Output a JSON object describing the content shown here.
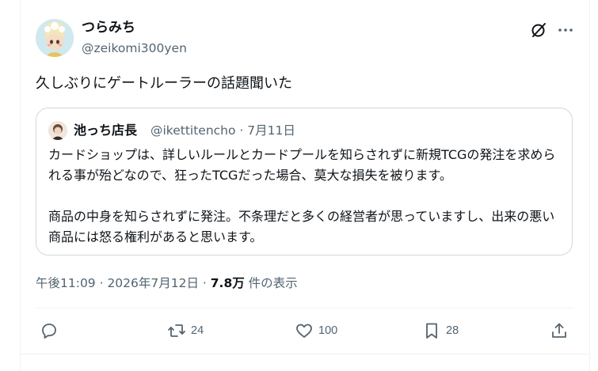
{
  "tweet": {
    "author_name": "つらみち",
    "author_handle": "@zeikomi300yen",
    "text": "久しぶりにゲートルーラーの話題聞いた"
  },
  "quote": {
    "author_name": "池っち店長",
    "author_handle_and_date": "@ikettitencho · 7月11日",
    "text": "カードショップは、詳しいルールとカードプールを知らされずに新規TCGの発注を求められる事が殆どなので、狂ったTCGだった場合、莫大な損失を被ります。\n\n商品の中身を知らされずに発注。不条理だと多くの経営者が思っていますし、出来の悪い商品には怒る権利があると思います。"
  },
  "meta": {
    "time": "午後11:09 · 2026年7月12日 · ",
    "views_count": "7.8万",
    "views_label": " 件の表示"
  },
  "actions": {
    "reply_count": "",
    "retweet_count": "24",
    "like_count": "100",
    "bookmark_count": "28"
  },
  "icons": [
    "grok-icon",
    "more-icon",
    "reply-icon",
    "retweet-icon",
    "like-icon",
    "bookmark-icon",
    "share-icon"
  ]
}
